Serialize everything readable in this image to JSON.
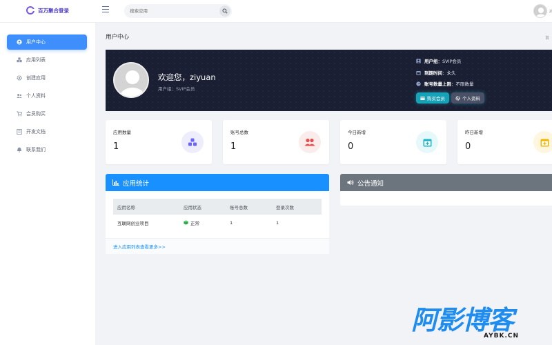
{
  "app": {
    "name": "百万聚合登录"
  },
  "search": {
    "placeholder": "搜索应用"
  },
  "sidebar": {
    "items": [
      {
        "label": "用户中心",
        "icon": "user-circle-icon",
        "active": true
      },
      {
        "label": "应用列表",
        "icon": "cubes-icon"
      },
      {
        "label": "创建应用",
        "icon": "gear-icon"
      },
      {
        "label": "个人资料",
        "icon": "users-icon"
      },
      {
        "label": "会员购买",
        "icon": "cart-icon"
      },
      {
        "label": "开发文档",
        "icon": "document-icon"
      },
      {
        "label": "联系我们",
        "icon": "bell-icon"
      }
    ]
  },
  "page": {
    "title": "用户中心",
    "crumb": "首"
  },
  "user": {
    "welcome": "欢迎您，ziyuan",
    "group_line": "用户组：SVIP会员",
    "info": [
      {
        "label": "用户组",
        "value": "SVIP会员",
        "icon": "user-icon"
      },
      {
        "label": "到期时间",
        "value": "永久",
        "icon": "calendar-icon"
      },
      {
        "label": "账号数量上限",
        "value": "不限数量",
        "icon": "gauge-icon"
      }
    ],
    "buttons": {
      "buy_vip": "购买会员",
      "profile": "个人资料"
    }
  },
  "stats": [
    {
      "label": "应用数量",
      "value": "1",
      "icon": "cubes-icon",
      "color": "#6c63ff"
    },
    {
      "label": "账号总数",
      "value": "1",
      "icon": "users-icon",
      "color": "#e84c4c"
    },
    {
      "label": "今日新增",
      "value": "0",
      "icon": "calendar-plus-icon",
      "color": "#17b6c9"
    },
    {
      "label": "昨日新增",
      "value": "0",
      "icon": "calendar-plus-icon",
      "color": "#f5b400"
    }
  ],
  "apps_panel": {
    "title": "应用统计",
    "columns": [
      "应用名称",
      "应用状态",
      "账号总数",
      "登录次数"
    ],
    "rows": [
      {
        "name": "互联网创业项目",
        "status": "正常",
        "accounts": "1",
        "logins": "1"
      }
    ],
    "footer": "进入应用列表查看更多>>"
  },
  "notice_panel": {
    "title": "公告通知"
  },
  "colors": {
    "accent": "#3e8efc",
    "panel_blue": "#1890ff",
    "panel_gray": "#6c757d",
    "hero_bg": "#1b1f33"
  },
  "watermark": {
    "title": "阿影博客",
    "sub": "AYBK.CN"
  }
}
